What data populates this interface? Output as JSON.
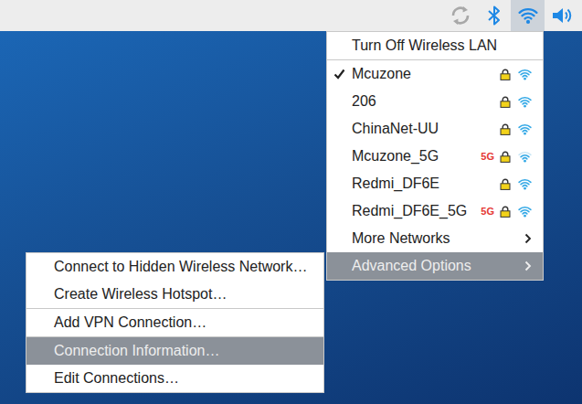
{
  "panel": {
    "network_menu_open": true
  },
  "menu": {
    "groups": [
      [
        {
          "kind": "action",
          "label": "Turn Off Wireless LAN",
          "selected": false
        }
      ],
      [
        {
          "kind": "network",
          "label": "Mcuzone",
          "connected": true,
          "secured": true,
          "band": "",
          "signal": 1,
          "selected": false
        },
        {
          "kind": "network",
          "label": "206",
          "connected": false,
          "secured": true,
          "band": "",
          "signal": 1,
          "selected": false
        },
        {
          "kind": "network",
          "label": "ChinaNet-UU",
          "connected": false,
          "secured": true,
          "band": "",
          "signal": 1,
          "selected": false
        },
        {
          "kind": "network",
          "label": "Mcuzone_5G",
          "connected": false,
          "secured": true,
          "band": "5G",
          "signal": 0.67,
          "selected": false
        },
        {
          "kind": "network",
          "label": "Redmi_DF6E",
          "connected": false,
          "secured": true,
          "band": "",
          "signal": 1,
          "selected": false
        },
        {
          "kind": "network",
          "label": "Redmi_DF6E_5G",
          "connected": false,
          "secured": true,
          "band": "5G",
          "signal": 1,
          "selected": false
        },
        {
          "kind": "submenu",
          "label": "More Networks",
          "selected": false
        },
        {
          "kind": "submenu",
          "label": "Advanced Options",
          "selected": true
        }
      ]
    ]
  },
  "submenu": {
    "groups": [
      [
        {
          "label": "Connect to Hidden Wireless Network…",
          "selected": false
        },
        {
          "label": "Create Wireless Hotspot…",
          "selected": false
        }
      ],
      [
        {
          "label": "Add VPN Connection…",
          "selected": false
        }
      ],
      [
        {
          "label": "Connection Information…",
          "selected": true
        },
        {
          "label": "Edit Connections…",
          "selected": false
        }
      ]
    ]
  }
}
